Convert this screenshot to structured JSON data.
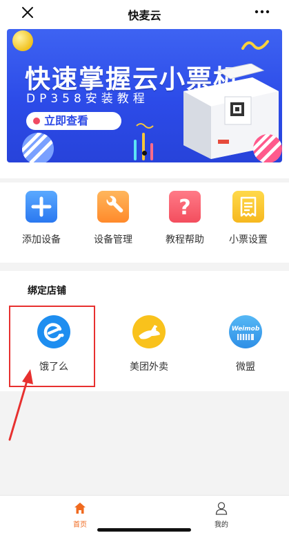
{
  "header": {
    "title": "快麦云",
    "close_icon": "close-icon",
    "more_icon": "more-icon"
  },
  "banner": {
    "headline": "快速掌握云小票机",
    "subline": "DP358安装教程",
    "cta_label": "立即查看",
    "accent": "#2c4be8"
  },
  "actions": [
    {
      "label": "添加设备",
      "icon": "plus-icon",
      "color": "#2a78f0"
    },
    {
      "label": "设备管理",
      "icon": "wrench-icon",
      "color": "#ff8a2b"
    },
    {
      "label": "教程帮助",
      "icon": "question-icon",
      "color": "#f34e5e"
    },
    {
      "label": "小票设置",
      "icon": "receipt-icon",
      "color": "#f6b81f"
    }
  ],
  "stores": {
    "title": "绑定店铺",
    "items": [
      {
        "label": "饿了么",
        "icon": "eleme-icon",
        "color": "#1e8ef0"
      },
      {
        "label": "美团外卖",
        "icon": "meituan-kangaroo-icon",
        "color": "#f9c21c"
      },
      {
        "label": "微盟",
        "icon": "weimob-icon",
        "color": "#2e8fe6",
        "logo_text": "Weimob"
      }
    ]
  },
  "tabbar": {
    "home": {
      "label": "首页",
      "icon": "home-icon",
      "active": true
    },
    "mine": {
      "label": "我的",
      "icon": "user-icon",
      "active": false
    },
    "accent": "#f06a1f"
  }
}
